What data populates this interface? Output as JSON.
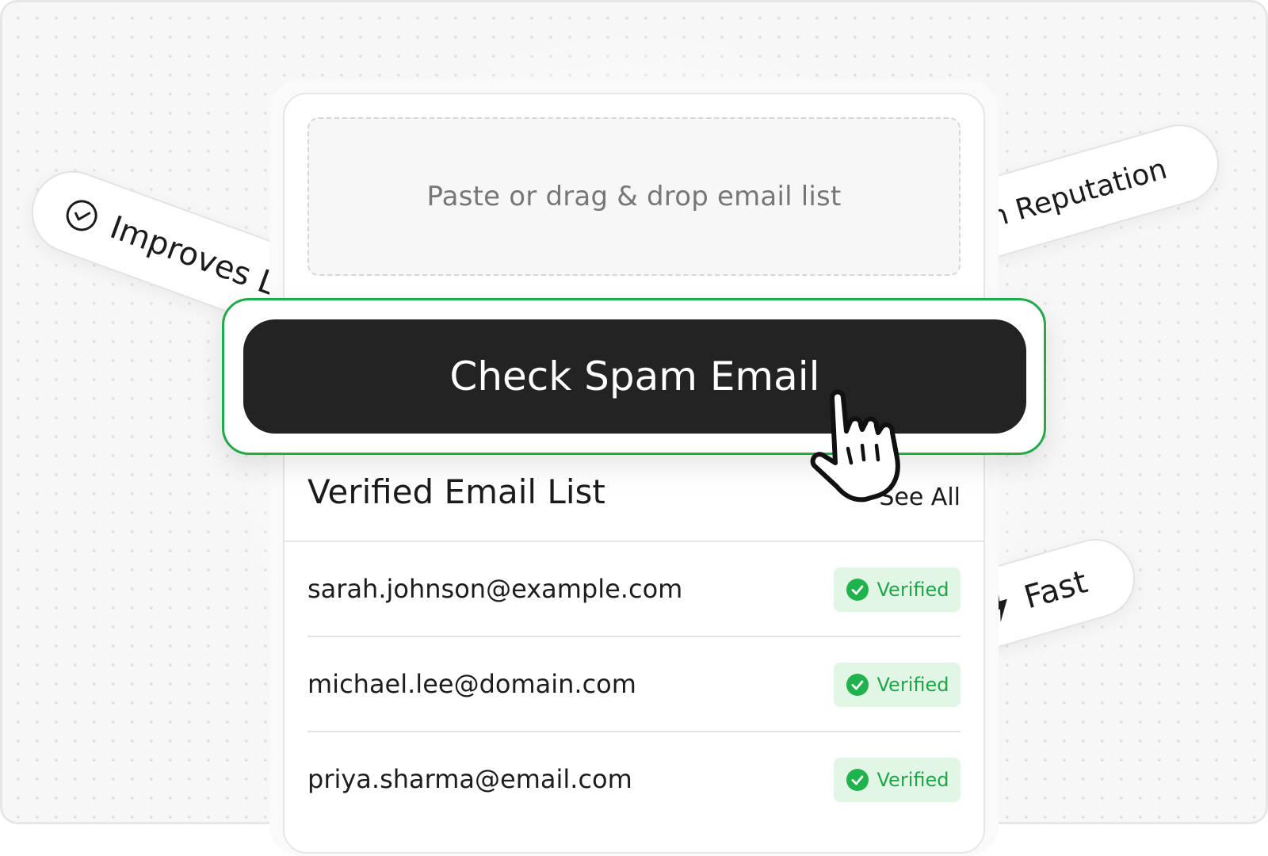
{
  "pills": {
    "left": {
      "label": "Improves L",
      "icon": "check-circle-icon"
    },
    "right": {
      "label": "n Reputation"
    },
    "fast": {
      "label": "Fast",
      "icon": "lightning-icon"
    }
  },
  "dropzone": {
    "placeholder": "Paste or drag & drop email list"
  },
  "primary_button": {
    "label": "Check Spam Email"
  },
  "list": {
    "title": "Verified Email List",
    "see_all": "See All",
    "rows": [
      {
        "email": "sarah.johnson@example.com",
        "status": "Verified"
      },
      {
        "email": "michael.lee@domain.com",
        "status": "Verified"
      },
      {
        "email": "priya.sharma@email.com",
        "status": "Verified"
      }
    ]
  },
  "colors": {
    "accent_green": "#23a84a",
    "badge_bg": "#e1f6e4",
    "button_bg": "#232323"
  },
  "icons": {
    "cursor": "hand-pointer-icon",
    "badge": "check-circle-filled-icon"
  }
}
